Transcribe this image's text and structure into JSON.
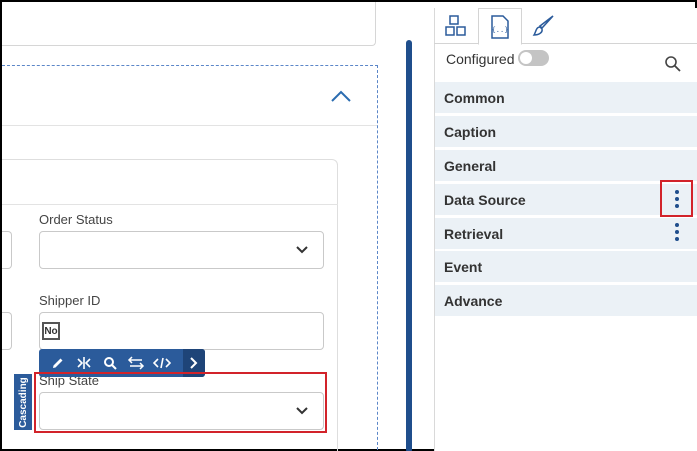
{
  "form": {
    "fields": [
      {
        "label": "Order Status",
        "value": ""
      },
      {
        "label": "Shipper ID",
        "value": "No"
      },
      {
        "label": "Ship State",
        "value": ""
      }
    ],
    "cascading_tag": "Cascading"
  },
  "toolbar": {
    "buttons": [
      "edit-icon",
      "split-icon",
      "search-icon",
      "swap-icon",
      "code-icon",
      "chevron-right-icon"
    ]
  },
  "right_panel": {
    "tabs": [
      "components-icon",
      "json-icon",
      "brush-icon"
    ],
    "active_tab": "json-icon",
    "configured_label": "Configured",
    "configured_on": false,
    "sections": [
      {
        "label": "Common",
        "has_menu": false
      },
      {
        "label": "Caption",
        "has_menu": false
      },
      {
        "label": "General",
        "has_menu": false
      },
      {
        "label": "Data Source",
        "has_menu": true
      },
      {
        "label": "Retrieval",
        "has_menu": true
      },
      {
        "label": "Event",
        "has_menu": false
      },
      {
        "label": "Advance",
        "has_menu": false
      }
    ]
  },
  "colors": {
    "accent": "#1f4e8c",
    "toolbar": "#2b5b9b",
    "highlight": "#d2232a",
    "section_bg": "#ebf1f6"
  }
}
